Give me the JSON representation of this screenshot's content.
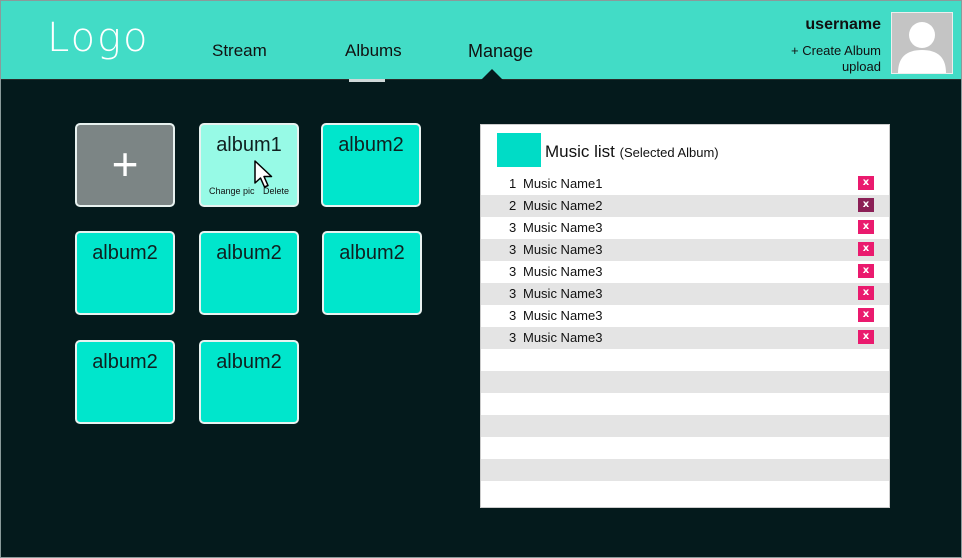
{
  "header": {
    "logo": "Logo",
    "nav": [
      "Stream",
      "Albums",
      "Manage"
    ],
    "username": "username",
    "create_album": "+ Create Album",
    "upload": "upload"
  },
  "albums": {
    "add_symbol": "+",
    "tiles": [
      "album1",
      "album2",
      "album2",
      "album2",
      "album2",
      "album2",
      "album2"
    ],
    "selected_actions": {
      "change_pic": "Change pic",
      "delete": "Delete"
    }
  },
  "music_list": {
    "title": "Music list",
    "subtitle": "(Selected Album)",
    "accent_color": "#00dcc6",
    "delete_label": "x",
    "tracks": [
      {
        "num": "1",
        "name": "Music Name1"
      },
      {
        "num": "2",
        "name": "Music Name2"
      },
      {
        "num": "3",
        "name": "Music Name3"
      },
      {
        "num": "3",
        "name": "Music Name3"
      },
      {
        "num": "3",
        "name": "Music Name3"
      },
      {
        "num": "3",
        "name": "Music Name3"
      },
      {
        "num": "3",
        "name": "Music Name3"
      },
      {
        "num": "3",
        "name": "Music Name3"
      }
    ]
  },
  "colors": {
    "header": "#42dcc6",
    "tile": "#00e6cc",
    "delete": "#ea1a6e",
    "background": "#041a1c"
  }
}
